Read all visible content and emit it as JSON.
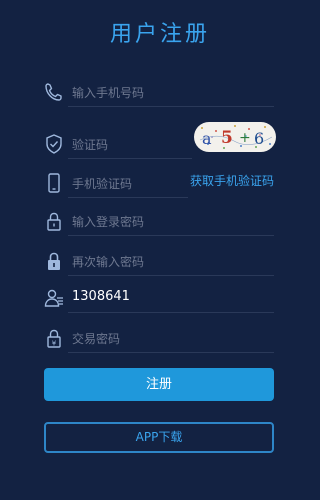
{
  "header": {
    "title": "用户注册"
  },
  "form": {
    "phone": {
      "placeholder": "输入手机号码",
      "icon": "phone-icon"
    },
    "captcha": {
      "placeholder": "验证码",
      "icon": "shield-icon",
      "image_text": "a 5 6"
    },
    "sms_code": {
      "placeholder": "手机验证码",
      "icon": "mobile-icon",
      "link_label": "获取手机验证码"
    },
    "login_password": {
      "placeholder": "输入登录密码",
      "icon": "lock-icon"
    },
    "confirm_password": {
      "placeholder": "再次输入密码",
      "icon": "lock-icon"
    },
    "referrer": {
      "value": "1308641",
      "icon": "user-card-icon"
    },
    "trade_password": {
      "placeholder": "交易密码",
      "icon": "lock-icon"
    }
  },
  "actions": {
    "register_label": "注册",
    "app_download_label": "APP下载"
  },
  "colors": {
    "background": "#132242",
    "accent": "#3aa4ee",
    "primary_button": "#1f98db"
  }
}
